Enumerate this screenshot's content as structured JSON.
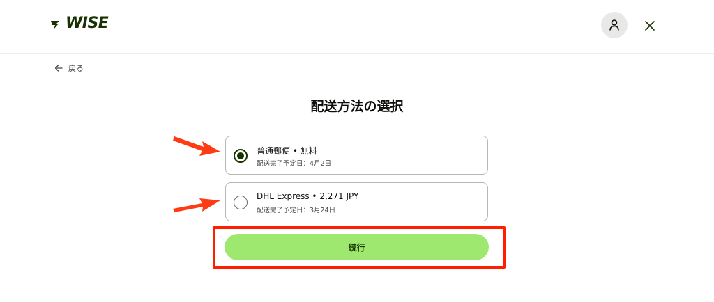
{
  "header": {
    "logo_text": "WISE",
    "avatar_icon": "user-icon",
    "close_icon": "close-icon"
  },
  "nav": {
    "back_label": "戻る",
    "back_icon": "arrow-left-icon"
  },
  "main": {
    "title": "配送方法の選択",
    "options": [
      {
        "title": "普通郵便 • 無料",
        "subtitle": "配送完了予定日：4月2日",
        "selected": true
      },
      {
        "title": "DHL Express • 2,271 JPY",
        "subtitle": "配送完了予定日：3月24日",
        "selected": false
      }
    ],
    "continue_label": "続行"
  },
  "annotations": {
    "arrow_color": "#ff3b14",
    "highlight_color": "#ff1e00"
  },
  "colors": {
    "brand_dark": "#163300",
    "brand_green": "#9fe870"
  }
}
